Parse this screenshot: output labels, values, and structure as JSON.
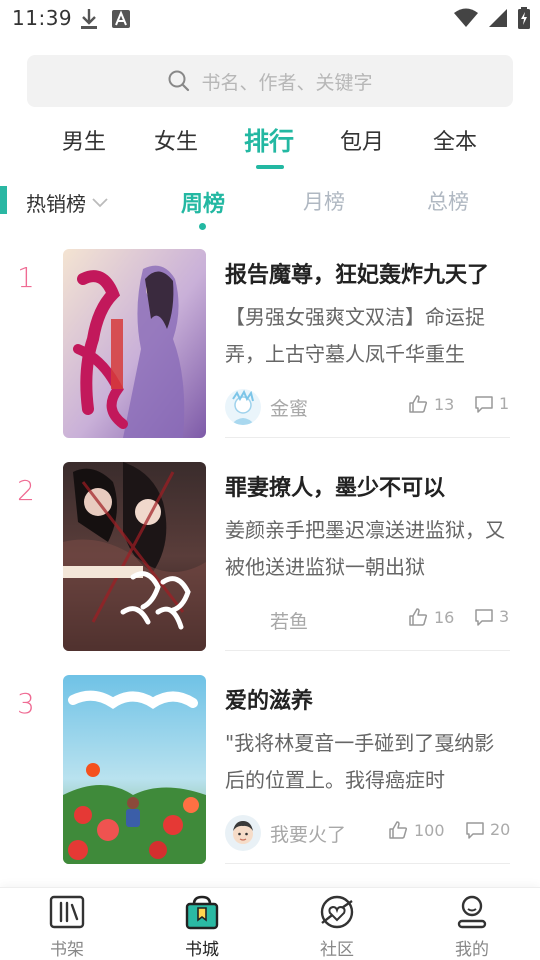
{
  "status_bar": {
    "time": "11:39",
    "left_icons": [
      "download-icon",
      "font-a-icon"
    ],
    "right_icons": [
      "wifi-icon",
      "signal-icon",
      "battery-charging-icon"
    ]
  },
  "search": {
    "placeholder": "书名、作者、关键字",
    "icon": "search-icon"
  },
  "category_tabs": [
    {
      "label": "男生",
      "active": false
    },
    {
      "label": "女生",
      "active": false
    },
    {
      "label": "排行",
      "active": true
    },
    {
      "label": "包月",
      "active": false
    },
    {
      "label": "全本",
      "active": false
    }
  ],
  "ranking": {
    "selected": "热销榜",
    "periods": [
      {
        "label": "周榜",
        "active": true
      },
      {
        "label": "月榜",
        "active": false
      },
      {
        "label": "总榜",
        "active": false
      }
    ]
  },
  "books": [
    {
      "rank": "1",
      "title": "报告魔尊，狂妃轰炸九天了",
      "description": "【男强女强爽文双洁】命运捉弄，上古守墓人凤千华重生",
      "author": "金蜜",
      "likes": "13",
      "comments": "1"
    },
    {
      "rank": "2",
      "title": "罪妻撩人，墨少不可以",
      "description": "姜颜亲手把墨迟凛送进监狱，又被他送进监狱一朝出狱",
      "author": "若鱼",
      "likes": "16",
      "comments": "3"
    },
    {
      "rank": "3",
      "title": "爱的滋养",
      "description": "\"我将林夏音一手碰到了戛纳影后的位置上。我得癌症时",
      "author": "我要火了",
      "likes": "100",
      "comments": "20"
    }
  ],
  "bottom_nav": [
    {
      "label": "书架",
      "icon": "bookshelf-icon",
      "active": false
    },
    {
      "label": "书城",
      "icon": "bookstore-icon",
      "active": true
    },
    {
      "label": "社区",
      "icon": "community-icon",
      "active": false
    },
    {
      "label": "我的",
      "icon": "profile-icon",
      "active": false
    }
  ],
  "colors": {
    "accent": "#23b8a2",
    "rank_number": "#ef6b93",
    "muted_text": "#a8a8a8"
  }
}
